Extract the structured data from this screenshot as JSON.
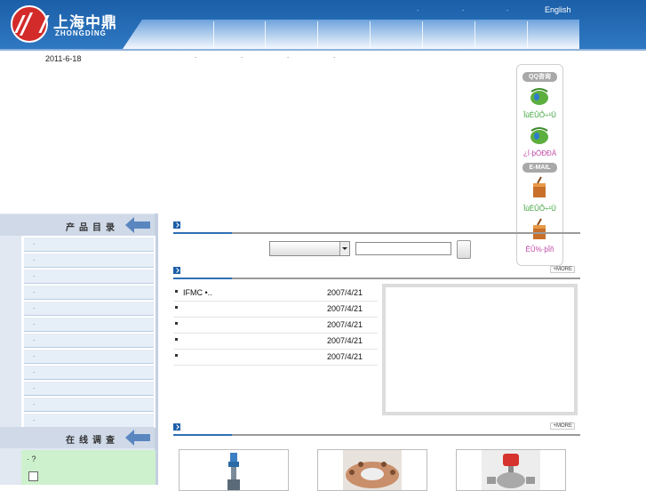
{
  "header": {
    "brand_cn": "上海中鼎",
    "brand_en": "ZHONGDING",
    "top_links": [
      ".",
      ".",
      "."
    ],
    "language_link": "English"
  },
  "date": "2011-6-18",
  "sub_links": [
    ".",
    ".",
    ".",
    "."
  ],
  "float_widget": {
    "qq_title": "QQ咨询",
    "qq_service_1": "ÎúÉÛÔ÷¹Ü",
    "qq_service_2": "¿Í·þÖÐÐÄ",
    "email_title": "E-MAIL",
    "email_service_1": "ÎúÉÛÔ÷¹Ü",
    "email_service_2": "ÊÛ%·þÎñ"
  },
  "sidebar": {
    "product_heading": "产品目录",
    "categories": [
      ".",
      ".",
      ".",
      ".",
      ".",
      ".",
      ".",
      ".",
      ".",
      ".",
      ".",
      "."
    ],
    "survey_heading": "在线调查",
    "survey_question": "·   ?"
  },
  "main": {
    "search_placeholder": "",
    "more_label": "+MORE",
    "news": [
      {
        "title": "IFMC     •..",
        "date": "2007/4/21"
      },
      {
        "title": "",
        "date": "2007/4/21"
      },
      {
        "title": "",
        "date": "2007/4/21"
      },
      {
        "title": "",
        "date": "2007/4/21"
      },
      {
        "title": "",
        "date": "2007/4/21"
      }
    ],
    "products": [
      {
        "icon": "valve-icon"
      },
      {
        "icon": "flange-icon"
      },
      {
        "icon": "pressure-valve-icon"
      }
    ]
  },
  "colors": {
    "header_blue": "#1b5fa8",
    "accent_blue": "#2e6fb5",
    "logo_red": "#d32a2a",
    "survey_green": "#cdf1cd"
  }
}
